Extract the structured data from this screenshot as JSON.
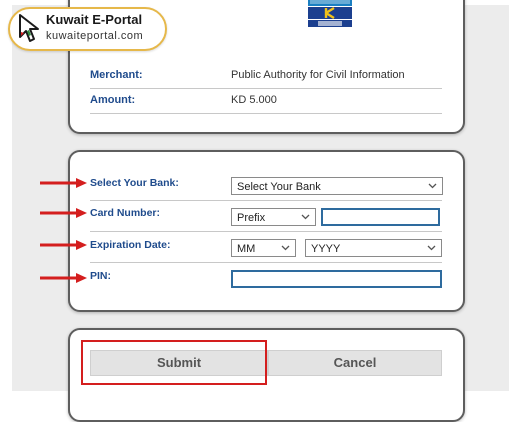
{
  "brand": {
    "title": "Kuwait E-Portal",
    "url": "kuwaiteportal.com"
  },
  "payment": {
    "merchant_label": "Merchant:",
    "merchant_value": "Public Authority for Civil Information",
    "amount_label": "Amount:",
    "amount_value": "KD 5.000"
  },
  "form": {
    "bank_label": "Select Your Bank:",
    "bank_select": "Select Your Bank",
    "card_label": "Card Number:",
    "prefix_select": "Prefix",
    "card_number_value": "",
    "expiry_label": "Expiration Date:",
    "month_select": "MM",
    "year_select": "YYYY",
    "pin_label": "PIN:",
    "pin_value": ""
  },
  "actions": {
    "submit_label": "Submit",
    "cancel_label": "Cancel"
  },
  "colors": {
    "label_blue": "#1f4b8c",
    "annotation_red": "#d41e1e",
    "input_focus_border": "#2e6b9e",
    "badge_border": "#e6b84a"
  },
  "icons": [
    "knet-logo",
    "red-annotation-arrow",
    "chevron-down-icon",
    "kuwait-portal-logo-icon"
  ]
}
